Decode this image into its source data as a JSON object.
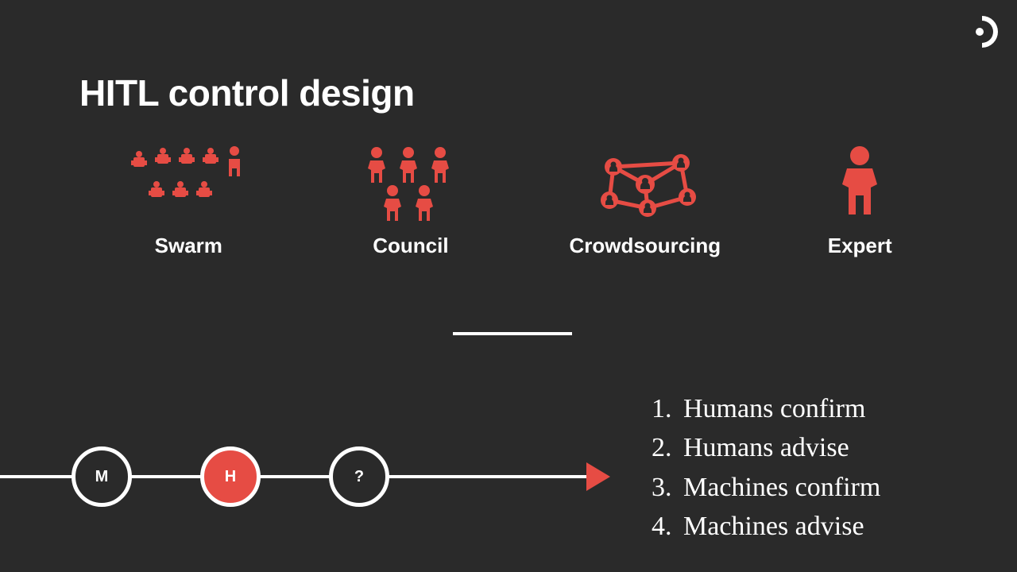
{
  "title": "HITL control design",
  "accent": "#e64c44",
  "categories": [
    {
      "label": "Swarm",
      "icon": "swarm-icon"
    },
    {
      "label": "Council",
      "icon": "council-icon"
    },
    {
      "label": "Crowdsourcing",
      "icon": "crowdsourcing-icon"
    },
    {
      "label": "Expert",
      "icon": "expert-icon"
    }
  ],
  "timeline": {
    "nodes": [
      {
        "letter": "M",
        "filled": false
      },
      {
        "letter": "H",
        "filled": true
      },
      {
        "letter": "?",
        "filled": false
      }
    ]
  },
  "list": [
    {
      "num": "1.",
      "text": "Humans confirm"
    },
    {
      "num": "2.",
      "text": "Humans advise"
    },
    {
      "num": "3.",
      "text": "Machines confirm"
    },
    {
      "num": "4.",
      "text": "Machines advise"
    }
  ]
}
